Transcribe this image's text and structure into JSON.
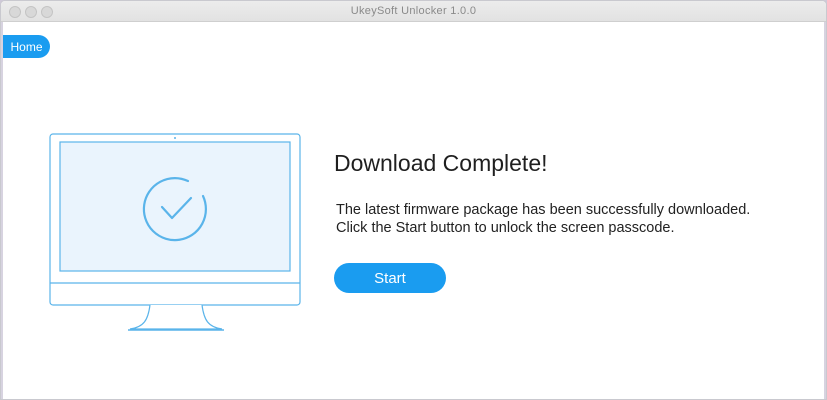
{
  "window": {
    "title": "UkeySoft Unlocker 1.0.0"
  },
  "nav": {
    "home_label": "Home"
  },
  "main": {
    "heading": "Download Complete!",
    "description_line1": "The latest firmware package has been successfully downloaded.",
    "description_line2": "Click the Start button to unlock the screen passcode.",
    "start_label": "Start"
  },
  "colors": {
    "accent": "#1a9cf0",
    "illustration_stroke": "#5ab4ea",
    "screen_fill": "#eaf4fd"
  },
  "icons": [
    "monitor-illustration",
    "checkmark-circle-icon"
  ]
}
